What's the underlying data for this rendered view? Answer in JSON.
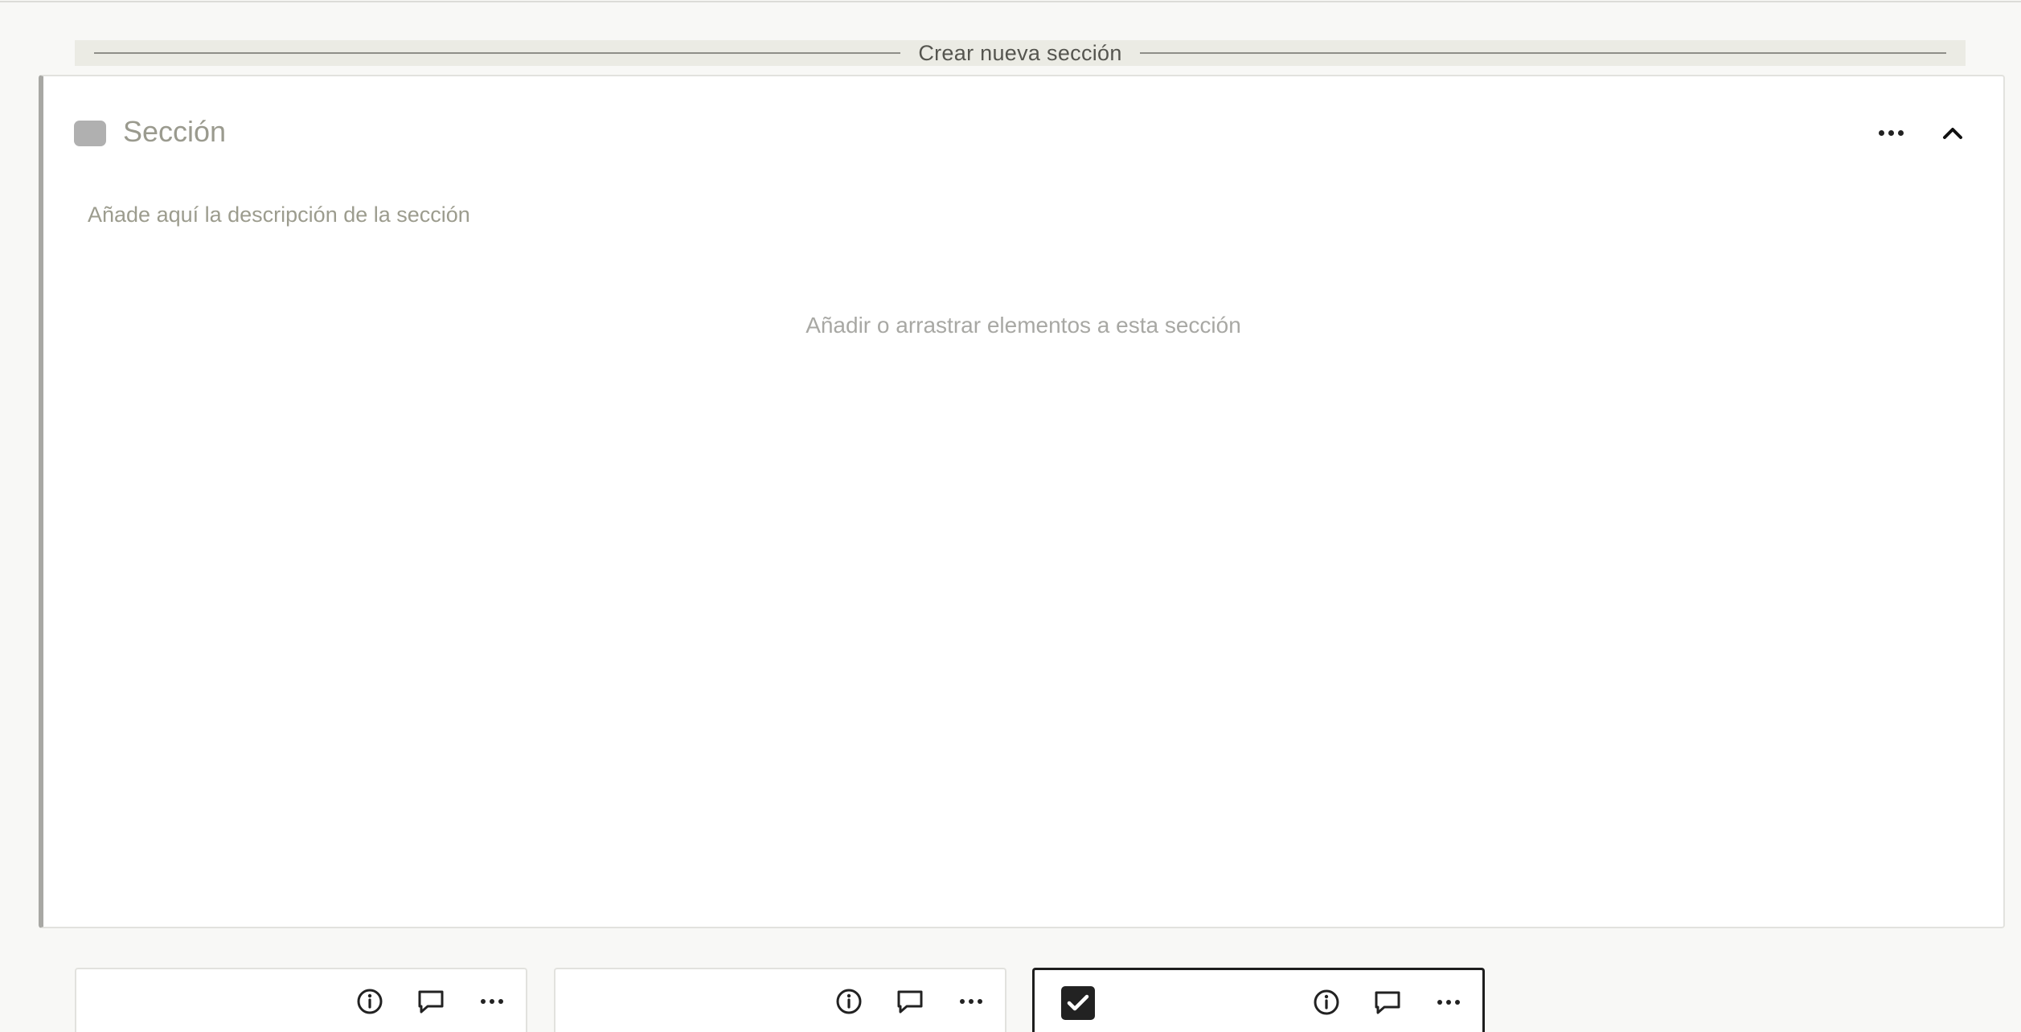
{
  "new_section_bar": {
    "label": "Crear nueva sección"
  },
  "section": {
    "title": "Sección",
    "description_placeholder": "Añade aquí la descripción de la sección",
    "empty_hint": "Añadir o arrastrar elementos a esta sección",
    "swatch_color": "#b0b0b0",
    "icons": {
      "more": "more-horizontal-icon",
      "collapse": "chevron-up-icon"
    }
  },
  "item_cards": [
    {
      "selected": false,
      "icons": [
        "info-icon",
        "comment-icon",
        "more-horizontal-icon"
      ]
    },
    {
      "selected": false,
      "icons": [
        "info-icon",
        "comment-icon",
        "more-horizontal-icon"
      ]
    },
    {
      "selected": true,
      "checked": true,
      "icons": [
        "checkbox-checked-icon",
        "info-icon",
        "comment-icon",
        "more-horizontal-icon"
      ]
    }
  ]
}
